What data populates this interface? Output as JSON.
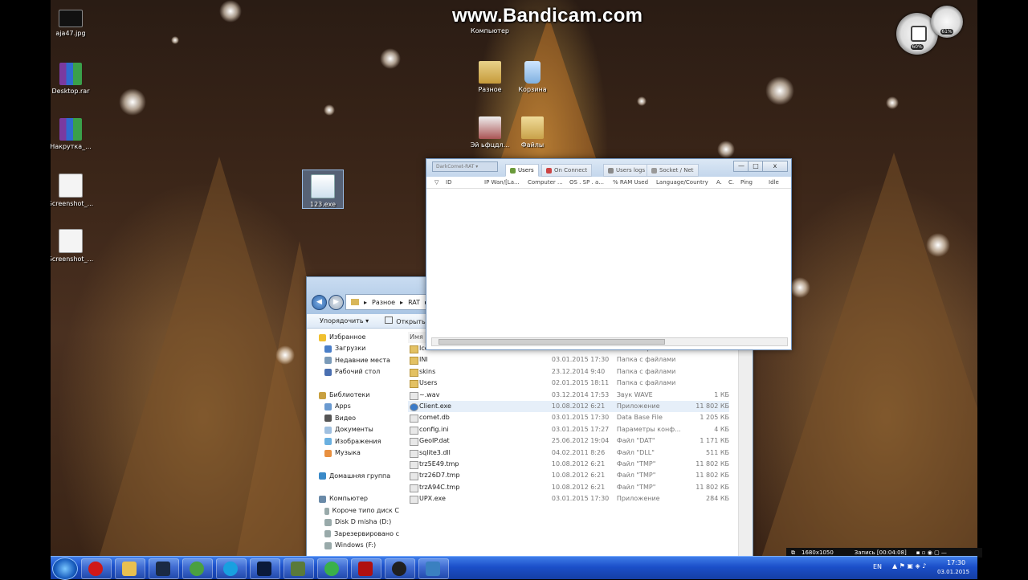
{
  "watermark": "www.Bandicam.com",
  "desktop": {
    "icons": [
      {
        "label": "aja47.jpg"
      },
      {
        "label": "Desktop.rar"
      },
      {
        "label": "Накрутка_..."
      },
      {
        "label": "Screenshot_..."
      },
      {
        "label": "Screenshot_..."
      },
      {
        "label": "123.exe"
      },
      {
        "label": "Компьютер"
      },
      {
        "label": "Разное"
      },
      {
        "label": "Корзина"
      },
      {
        "label": "Эй ьфцдл..."
      },
      {
        "label": "Файлы"
      }
    ],
    "gadgets": [
      {
        "value": "60%"
      },
      {
        "value": "61%"
      }
    ]
  },
  "rat": {
    "menu": "DarkComet-RAT",
    "tabs": [
      "Users",
      "On Connect",
      "Users logs",
      "Socket / Net"
    ],
    "buttons": {
      "minimize": "—",
      "maximize": "□",
      "close": "x"
    },
    "columns": [
      "ID",
      "IP Wan/[La...",
      "Computer ...",
      "OS . SP . a...",
      "% RAM Used",
      "Language/Country",
      "A.",
      "C.",
      "Ping",
      "Idle"
    ]
  },
  "explorer": {
    "address": [
      "Разное",
      "RAT"
    ],
    "toolbar": [
      "Упорядочить",
      "Открыть"
    ],
    "nav": [
      {
        "label": "Избранное",
        "group": true
      },
      {
        "label": "Загрузки"
      },
      {
        "label": "Недавние места"
      },
      {
        "label": "Рабочий стол"
      },
      {
        "label": ""
      },
      {
        "label": "Библиотеки",
        "group": true
      },
      {
        "label": "Apps"
      },
      {
        "label": "Видео"
      },
      {
        "label": "Документы"
      },
      {
        "label": "Изображения"
      },
      {
        "label": "Музыка"
      },
      {
        "label": ""
      },
      {
        "label": "Домашняя группа",
        "group": true
      },
      {
        "label": ""
      },
      {
        "label": "Компьютер",
        "group": true
      },
      {
        "label": "Короче типо диск C"
      },
      {
        "label": "Disk D misha (D:)"
      },
      {
        "label": "Зарезервировано с"
      },
      {
        "label": "Windows (F:)"
      }
    ],
    "header": "Имя",
    "files": [
      {
        "name": "Icons",
        "date": "23.12.2014 9:38",
        "type": "Папка с файлами",
        "size": "",
        "kind": "folder"
      },
      {
        "name": "INI",
        "date": "03.01.2015 17:30",
        "type": "Папка с файлами",
        "size": "",
        "kind": "folder"
      },
      {
        "name": "skins",
        "date": "23.12.2014 9:40",
        "type": "Папка с файлами",
        "size": "",
        "kind": "folder"
      },
      {
        "name": "Users",
        "date": "02.01.2015 18:11",
        "type": "Папка с файлами",
        "size": "",
        "kind": "folder"
      },
      {
        "name": "~.wav",
        "date": "03.12.2014 17:53",
        "type": "Звук WAVE",
        "size": "1 КБ",
        "kind": "file"
      },
      {
        "name": "Client.exe",
        "date": "10.08.2012 6:21",
        "type": "Приложение",
        "size": "11 802 КБ",
        "kind": "exe"
      },
      {
        "name": "comet.db",
        "date": "03.01.2015 17:30",
        "type": "Data Base File",
        "size": "1 205 КБ",
        "kind": "file"
      },
      {
        "name": "config.ini",
        "date": "03.01.2015 17:27",
        "type": "Параметры конф...",
        "size": "4 КБ",
        "kind": "file"
      },
      {
        "name": "GeoIP.dat",
        "date": "25.06.2012 19:04",
        "type": "Файл \"DAT\"",
        "size": "1 171 КБ",
        "kind": "file"
      },
      {
        "name": "sqlite3.dll",
        "date": "04.02.2011 8:26",
        "type": "Файл \"DLL\"",
        "size": "511 КБ",
        "kind": "file"
      },
      {
        "name": "trz5E49.tmp",
        "date": "10.08.2012 6:21",
        "type": "Файл \"TMP\"",
        "size": "11 802 КБ",
        "kind": "file"
      },
      {
        "name": "trz26D7.tmp",
        "date": "10.08.2012 6:21",
        "type": "Файл \"TMP\"",
        "size": "11 802 КБ",
        "kind": "file"
      },
      {
        "name": "trzA94C.tmp",
        "date": "10.08.2012 6:21",
        "type": "Файл \"TMP\"",
        "size": "11 802 КБ",
        "kind": "file"
      },
      {
        "name": "UPX.exe",
        "date": "03.01.2015 17:30",
        "type": "Приложение",
        "size": "284 КБ",
        "kind": "file"
      }
    ]
  },
  "recorder": {
    "resolution": "1680x1050",
    "status": "Запись [00:04:08]"
  },
  "taskbar": {
    "apps": [
      "opera",
      "explorer",
      "steam",
      "utorrent",
      "skype",
      "photoshop",
      "calc",
      "chrome",
      "flash",
      "bandicam",
      "darkcomet"
    ],
    "lang": "EN",
    "time": "17:30",
    "date": "03.01.2015"
  }
}
